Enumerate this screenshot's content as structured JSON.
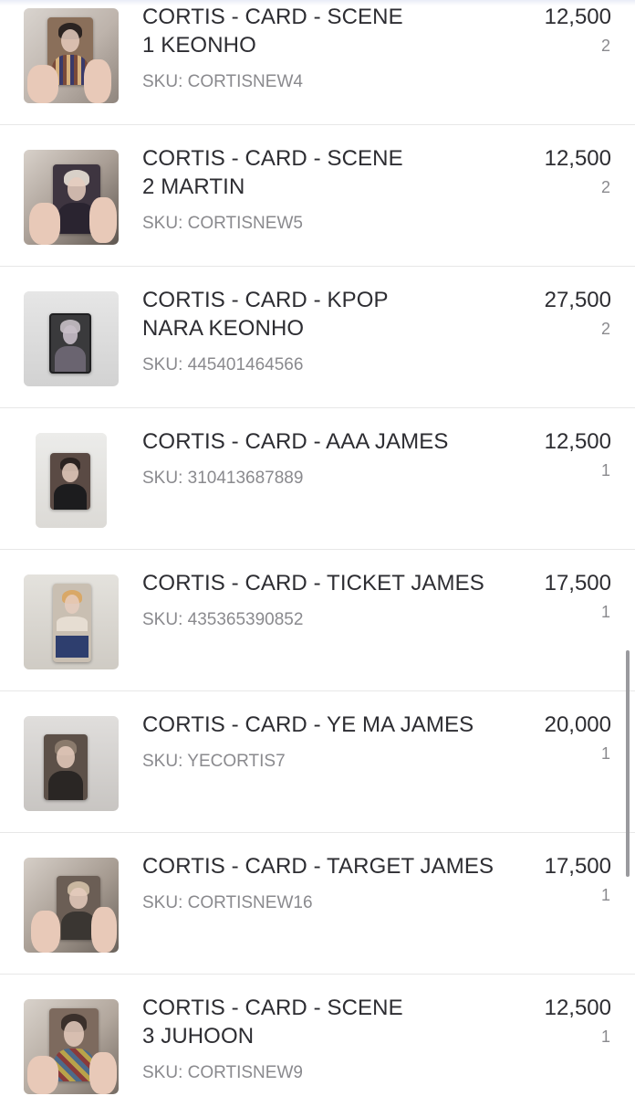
{
  "items": [
    {
      "title": "CORTIS - CARD - SCENE\n1 KEONHO",
      "sku": "SKU: CORTISNEW4",
      "price": "12,500",
      "qty": "2"
    },
    {
      "title": "CORTIS - CARD - SCENE\n2 MARTIN",
      "sku": "SKU: CORTISNEW5",
      "price": "12,500",
      "qty": "2"
    },
    {
      "title": "CORTIS - CARD - KPOP\nNARA KEONHO",
      "sku": "SKU: 445401464566",
      "price": "27,500",
      "qty": "2"
    },
    {
      "title": "CORTIS - CARD - AAA JAMES",
      "sku": "SKU: 310413687889",
      "price": "12,500",
      "qty": "1"
    },
    {
      "title": "CORTIS - CARD - TICKET JAMES",
      "sku": "SKU: 435365390852",
      "price": "17,500",
      "qty": "1"
    },
    {
      "title": "CORTIS - CARD - YE MA JAMES",
      "sku": "SKU: YECORTIS7",
      "price": "20,000",
      "qty": "1"
    },
    {
      "title": "CORTIS - CARD - TARGET JAMES",
      "sku": "SKU: CORTISNEW16",
      "price": "17,500",
      "qty": "1"
    },
    {
      "title": "CORTIS - CARD - SCENE\n3 JUHOON",
      "sku": "SKU: CORTISNEW9",
      "price": "12,500",
      "qty": "1"
    }
  ],
  "colors": {
    "text": "#2d2d32",
    "muted": "#8a8a8e",
    "divider": "#e7e7e7"
  }
}
